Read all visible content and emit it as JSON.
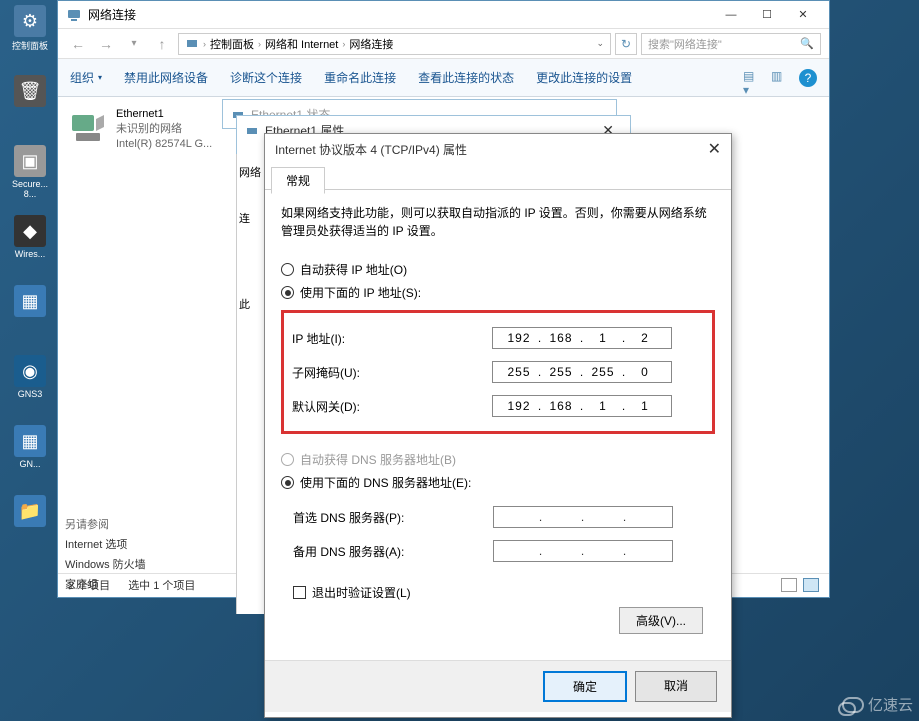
{
  "desktop": {
    "ctrl_label": "控制面板",
    "secure_label": "Secure...",
    "secure_sub": "8...",
    "wire_label": "Wires...",
    "gns_label": "GNS3",
    "gn_label": "GN..."
  },
  "network_window": {
    "title": "网络连接",
    "breadcrumb": {
      "a": "控制面板",
      "b": "网络和 Internet",
      "c": "网络连接"
    },
    "search_placeholder": "搜索\"网络连接\"",
    "toolbar": {
      "organize": "组织",
      "disable": "禁用此网络设备",
      "diagnose": "诊断这个连接",
      "rename": "重命名此连接",
      "view_status": "查看此连接的状态",
      "change_settings": "更改此连接的设置"
    },
    "adapter": {
      "name": "Ethernet1",
      "status": "未识别的网络",
      "driver": "Intel(R) 82574L G..."
    },
    "status_bar": {
      "items": "2 个项目",
      "selected": "选中 1 个项目"
    },
    "sidebar_links": {
      "l1": "另请参阅",
      "l2": "Internet 选项",
      "l3": "Windows 防火墙",
      "l4": "家庭组"
    }
  },
  "status_window": {
    "title": "Ethernet1 状态"
  },
  "props_window": {
    "title": "Ethernet1 属性",
    "network_label": "网络",
    "connect_label": "连",
    "this_label": "此"
  },
  "ipv4": {
    "title": "Internet 协议版本 4 (TCP/IPv4) 属性",
    "tab_general": "常规",
    "info": "如果网络支持此功能，则可以获取自动指派的 IP 设置。否则，你需要从网络系统管理员处获得适当的 IP 设置。",
    "radio_auto_ip": "自动获得 IP 地址(O)",
    "radio_use_ip": "使用下面的 IP 地址(S):",
    "label_ip": "IP 地址(I):",
    "label_mask": "子网掩码(U):",
    "label_gateway": "默认网关(D):",
    "ip_oct": [
      "192",
      "168",
      "1",
      "2"
    ],
    "mask_oct": [
      "255",
      "255",
      "255",
      "0"
    ],
    "gw_oct": [
      "192",
      "168",
      "1",
      "1"
    ],
    "radio_auto_dns": "自动获得 DNS 服务器地址(B)",
    "radio_use_dns": "使用下面的 DNS 服务器地址(E):",
    "label_dns1": "首选 DNS 服务器(P):",
    "label_dns2": "备用 DNS 服务器(A):",
    "validate_chk": "退出时验证设置(L)",
    "advanced": "高级(V)...",
    "ok": "确定",
    "cancel": "取消"
  },
  "watermark": "亿速云"
}
